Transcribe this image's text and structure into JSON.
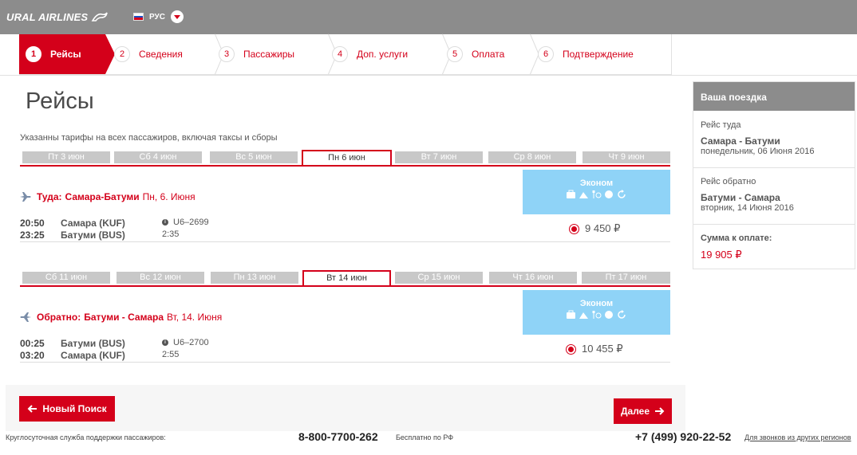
{
  "header": {
    "brand": "URAL AIRLINES",
    "language": "РУС",
    "colors": {
      "bar": "#8c8c8c",
      "accent": "#d4001a",
      "economy": "#8fd3f7"
    }
  },
  "steps": [
    {
      "num": "1",
      "label": "Рейсы",
      "active": true
    },
    {
      "num": "2",
      "label": "Сведения"
    },
    {
      "num": "3",
      "label": "Пассажиры"
    },
    {
      "num": "4",
      "label": "Доп. услуги"
    },
    {
      "num": "5",
      "label": "Оплата"
    },
    {
      "num": "6",
      "label": "Подтверждение"
    }
  ],
  "main": {
    "title": "Рейсы",
    "fare_note": "Указанны тарифы на всех пассажиров, включая таксы и сборы"
  },
  "outbound": {
    "dates": [
      "Пт 3 июн",
      "Сб 4 июн",
      "Вс 5 июн",
      "Пн 6 июн",
      "Вт 7 июн",
      "Ср 8 июн",
      "Чт 9 июн"
    ],
    "selected_index": 3,
    "label": "Туда:",
    "route": "Самара-Батуми",
    "date": "Пн, 6. Июня",
    "dep_time": "20:50",
    "arr_time": "23:25",
    "dep_airport": "Самара (KUF)",
    "arr_airport": "Батуми (BUS)",
    "flight_no": "U6–2699",
    "duration": "2:35",
    "class": "Эконом",
    "price": "9 450 ₽"
  },
  "return": {
    "dates": [
      "Сб 11 июн",
      "Вс 12 июн",
      "Пн 13 июн",
      "Вт 14 июн",
      "Ср 15 июн",
      "Чт 16 июн",
      "Пт 17 июн"
    ],
    "selected_index": 3,
    "label": "Обратно:",
    "route": "Батуми - Самара",
    "date": "Вт, 14. Июня",
    "dep_time": "00:25",
    "arr_time": "03:20",
    "dep_airport": "Батуми (BUS)",
    "arr_airport": "Самара (KUF)",
    "flight_no": "U6–2700",
    "duration": "2:55",
    "class": "Эконом",
    "price": "10 455 ₽"
  },
  "buttons": {
    "new_search": "Новый Поиск",
    "next": "Далее"
  },
  "footer": {
    "support_text": "Круглосуточная служба поддержки пассажиров:",
    "phone_free": "8-800-7700-262",
    "free_note": "Бесплатно по РФ",
    "phone_other": "+7 (499) 920-22-52",
    "other_note": "Для звонков из других регионов"
  },
  "trip": {
    "heading": "Ваша поездка",
    "outbound_label": "Рейс туда",
    "outbound_route": "Самара - Батуми",
    "outbound_date": "понедельник, 06 Июня 2016",
    "return_label": "Рейс обратно",
    "return_route": "Батуми - Самара",
    "return_date": "вторник, 14 Июня 2016",
    "total_label": "Сумма к оплате:",
    "total": "19 905 ₽"
  }
}
